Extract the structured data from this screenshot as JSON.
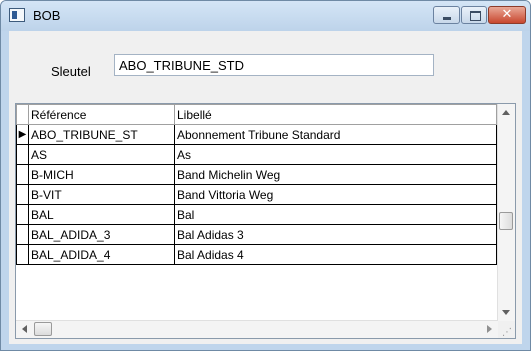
{
  "window": {
    "title": "BOB",
    "close_glyph": "✕"
  },
  "form": {
    "sleutel_label": "Sleutel",
    "key_value": "ABO_TRIBUNE_STD"
  },
  "grid": {
    "columns": [
      "Référence",
      "Libellé"
    ],
    "current_row_indicator": "▶",
    "rows": [
      {
        "reference": "ABO_TRIBUNE_ST",
        "libelle": "Abonnement Tribune Standard",
        "current": true
      },
      {
        "reference": "AS",
        "libelle": "As",
        "current": false
      },
      {
        "reference": "B-MICH",
        "libelle": "Band Michelin Weg",
        "current": false
      },
      {
        "reference": "B-VIT",
        "libelle": "Band Vittoria Weg",
        "current": false
      },
      {
        "reference": "BAL",
        "libelle": "Bal",
        "current": false
      },
      {
        "reference": "BAL_ADIDA_3",
        "libelle": "Bal Adidas 3",
        "current": false
      },
      {
        "reference": "BAL_ADIDA_4",
        "libelle": "Bal Adidas 4",
        "current": false
      }
    ]
  },
  "colors": {
    "title_bar": "#bfd5ec",
    "client_background": "#f0f0f0",
    "close_button": "#c8472e"
  }
}
